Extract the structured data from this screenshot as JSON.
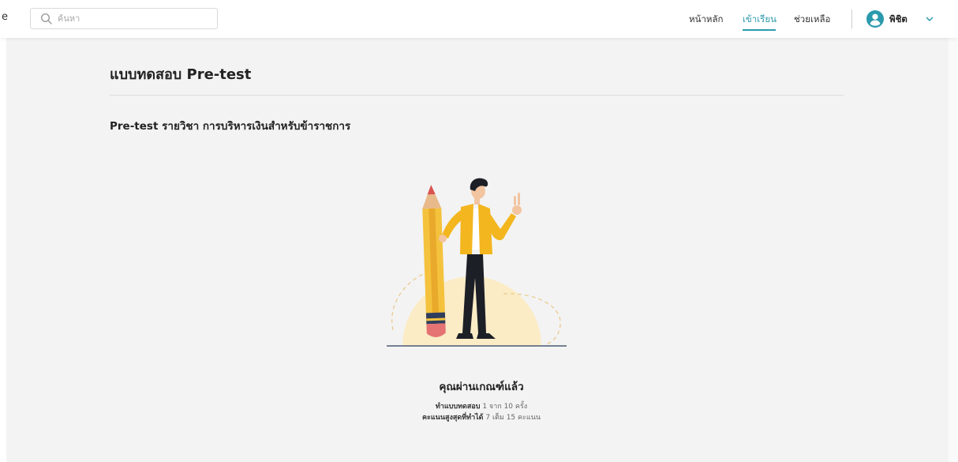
{
  "header": {
    "brand_fragment": "e",
    "search_placeholder": "ค้นหา",
    "nav": {
      "home": "หน้าหลัก",
      "learn": "เข้าเรียน",
      "help": "ช่วยเหลือ"
    },
    "user_name": "พิชิต",
    "active_color": "#2c9aad"
  },
  "page": {
    "title": "แบบทดสอบ Pre-test",
    "subject": "Pre-test รายวิชา การบริหารเงินสำหรับข้าราชการ"
  },
  "result": {
    "heading": "คุณผ่านเกณฑ์แล้ว",
    "attempts_label": "ทำแบบทดสอบ",
    "attempts_value": "1 จาก 10 ครั้ง",
    "score_label": "คะแนนสูงสุดที่ทำได้",
    "score_value": "7 เต็ม 15 คะแนน"
  },
  "icons": {
    "search": "search-icon",
    "avatar": "user-avatar-icon",
    "chevron": "chevron-down-icon"
  }
}
